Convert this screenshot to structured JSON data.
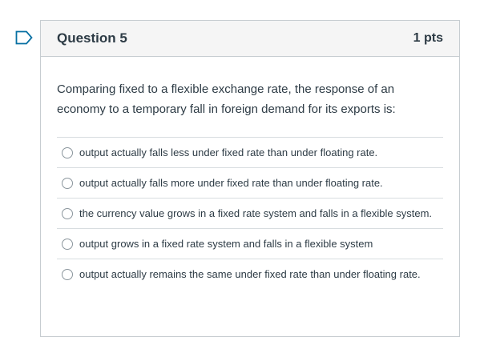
{
  "question": {
    "title": "Question 5",
    "points": "1 pts",
    "text": "Comparing fixed to a flexible exchange rate, the response of an economy to a temporary fall in foreign demand for its exports is:",
    "answers": [
      {
        "label": "output actually falls less under fixed rate than under floating rate."
      },
      {
        "label": "output actually falls more under fixed rate than under floating rate."
      },
      {
        "label": "the currency value grows in a fixed rate system and falls in a flexible system."
      },
      {
        "label": "output grows in a fixed rate system and falls in a flexible system"
      },
      {
        "label": "output actually remains the same under fixed rate than under floating rate."
      }
    ]
  },
  "colors": {
    "flag": "#0770a3",
    "header_bg": "#f5f5f5",
    "border": "#c7cdd1",
    "text": "#2d3b45"
  },
  "icons": {
    "flag": "flag-outline-icon",
    "radio": "radio-unchecked-icon"
  }
}
